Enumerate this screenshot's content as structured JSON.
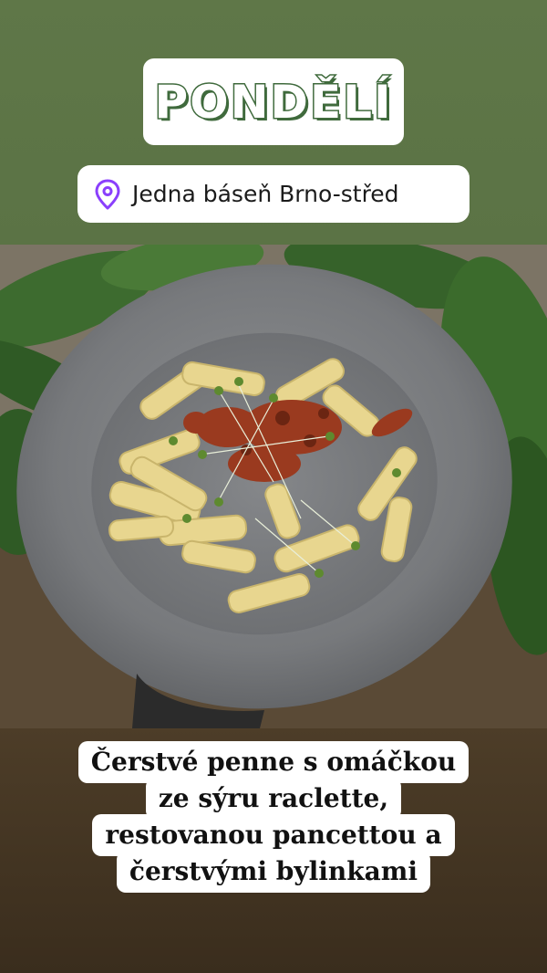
{
  "story": {
    "day_label": "PONDĚLÍ",
    "location": {
      "icon": "location-pin-icon",
      "text": "Jedna báseň Brno-střed",
      "icon_color": "#8a3ffc"
    },
    "photo": {
      "subject": "pasta-dish-photo"
    },
    "caption_lines": [
      "Čerstvé penne s omáčkou",
      "ze sýru raclette,",
      "restovanou pancettou a",
      "čerstvými bylinkami"
    ]
  },
  "colors": {
    "top_band": "#5f7748",
    "day_outline": "#3f6a3c",
    "bottom_band": "#45362a"
  }
}
